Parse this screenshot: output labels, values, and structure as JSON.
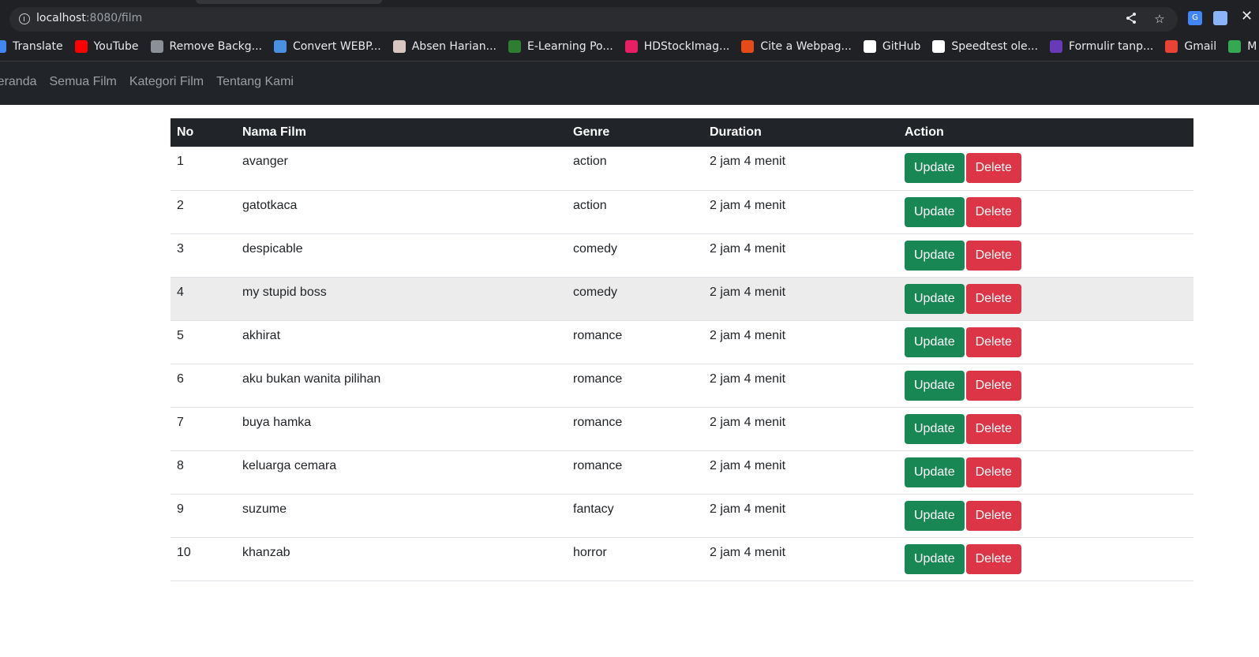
{
  "browser": {
    "url_host": "localhost",
    "url_path": ":8080/film",
    "bookmarks": [
      {
        "label": "Translate",
        "icon": "translate-icon",
        "color": "#4285f4"
      },
      {
        "label": "YouTube",
        "icon": "youtube-icon",
        "color": "#ff0000"
      },
      {
        "label": "Remove Backg...",
        "icon": "layers-icon",
        "color": "#8a8f98"
      },
      {
        "label": "Convert WEBP...",
        "icon": "diamond-icon",
        "color": "#4a90e2"
      },
      {
        "label": "Absen Harian...",
        "icon": "calendar-icon",
        "color": "#d8c7c0"
      },
      {
        "label": "E-Learning Po...",
        "icon": "elearning-icon",
        "color": "#2e7d32"
      },
      {
        "label": "HDStockImag...",
        "icon": "hd-icon",
        "color": "#e91e63"
      },
      {
        "label": "Cite a Webpag...",
        "icon": "cap-icon",
        "color": "#e64a19"
      },
      {
        "label": "GitHub",
        "icon": "github-icon",
        "color": "#ffffff"
      },
      {
        "label": "Speedtest ole...",
        "icon": "speedometer-icon",
        "color": "#ffffff"
      },
      {
        "label": "Formulir tanp...",
        "icon": "forms-icon",
        "color": "#673ab7"
      },
      {
        "label": "Gmail",
        "icon": "gmail-icon",
        "color": "#ea4335"
      },
      {
        "label": "M",
        "icon": "maps-icon",
        "color": "#34a853"
      }
    ]
  },
  "nav": {
    "items": [
      "Beranda",
      "Semua Film",
      "Kategori Film",
      "Tentang Kami"
    ]
  },
  "table": {
    "headers": [
      "No",
      "Nama Film",
      "Genre",
      "Duration",
      "Action"
    ],
    "update_label": "Update",
    "delete_label": "Delete",
    "rows": [
      {
        "no": "1",
        "nama": "avanger",
        "genre": "action",
        "duration": "2 jam 4 menit"
      },
      {
        "no": "2",
        "nama": "gatotkaca",
        "genre": "action",
        "duration": "2 jam 4 menit"
      },
      {
        "no": "3",
        "nama": "despicable",
        "genre": "comedy",
        "duration": "2 jam 4 menit"
      },
      {
        "no": "4",
        "nama": "my stupid boss",
        "genre": "comedy",
        "duration": "2 jam 4 menit"
      },
      {
        "no": "5",
        "nama": "akhirat",
        "genre": "romance",
        "duration": "2 jam 4 menit"
      },
      {
        "no": "6",
        "nama": "aku bukan wanita pilihan",
        "genre": "romance",
        "duration": "2 jam 4 menit"
      },
      {
        "no": "7",
        "nama": "buya hamka",
        "genre": "romance",
        "duration": "2 jam 4 menit"
      },
      {
        "no": "8",
        "nama": "keluarga cemara",
        "genre": "romance",
        "duration": "2 jam 4 menit"
      },
      {
        "no": "9",
        "nama": "suzume",
        "genre": "fantacy",
        "duration": "2 jam 4 menit"
      },
      {
        "no": "10",
        "nama": "khanzab",
        "genre": "horror",
        "duration": "2 jam 4 menit"
      }
    ]
  },
  "colors": {
    "update_button": "#198754",
    "delete_button": "#dc3545",
    "navbar": "#212529",
    "table_header": "#212529"
  }
}
